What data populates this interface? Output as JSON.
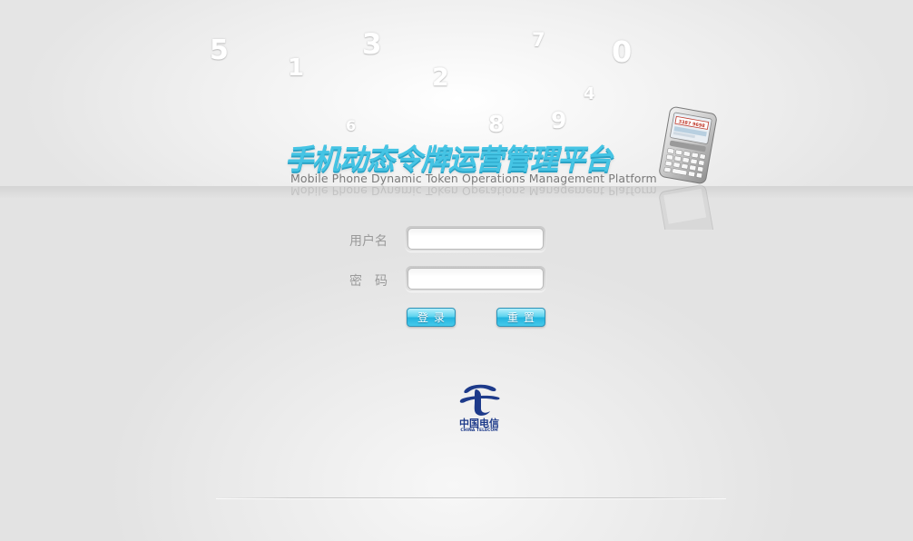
{
  "background_digits": [
    "5",
    "1",
    "3",
    "2",
    "7",
    "4",
    "0",
    "6",
    "8",
    "9"
  ],
  "header": {
    "title_cn": "手机动态令牌运营管理平台",
    "title_en": "Mobile Phone Dynamic Token Operations Management Platform",
    "phone_screen_text": "3387 9698"
  },
  "login_form": {
    "username_label": "用户名",
    "username_value": "",
    "password_label": "密　码",
    "password_value": "",
    "login_button": "登录",
    "reset_button": "重置"
  },
  "footer": {
    "logo_cn": "中国电信",
    "logo_en": "CHINA TELECOM"
  },
  "colors": {
    "title_accent": "#45c4e4",
    "button_accent": "#22b4de",
    "logo_blue": "#1d3a8a"
  },
  "icons": [
    "phone-illustration",
    "china-telecom-logo"
  ]
}
